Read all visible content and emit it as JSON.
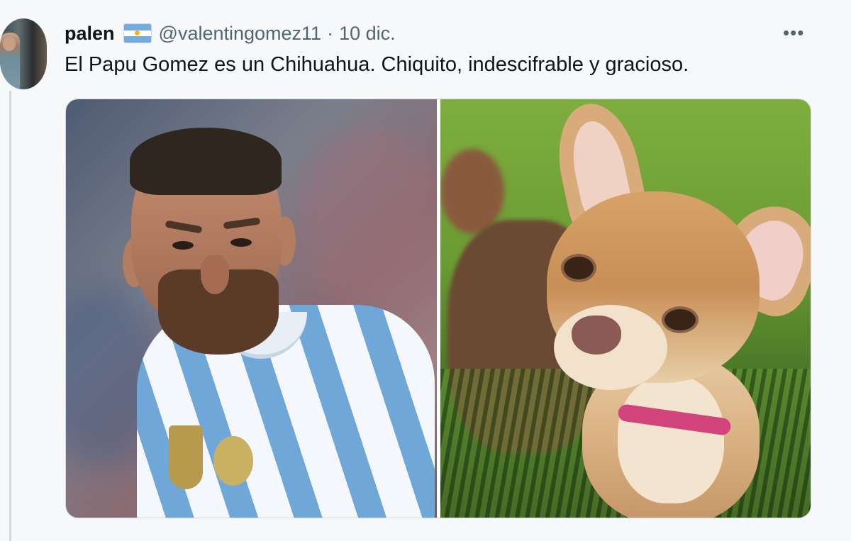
{
  "tweet": {
    "display_name": "palen",
    "flag": "argentina-flag",
    "handle": "@valentingomez11",
    "separator": "·",
    "date": "10 dic.",
    "more_label": "•••",
    "text": "El Papu Gomez es un Chihuahua. Chiquito, indescifrable y gracioso.",
    "media": [
      {
        "subject": "football-player-photo"
      },
      {
        "subject": "chihuahua-photo"
      }
    ]
  },
  "colors": {
    "background": "#f7f8f9",
    "text_primary": "#0f1419",
    "text_secondary": "#536471",
    "border": "#cfd9de",
    "flag_blue": "#74acdf"
  }
}
